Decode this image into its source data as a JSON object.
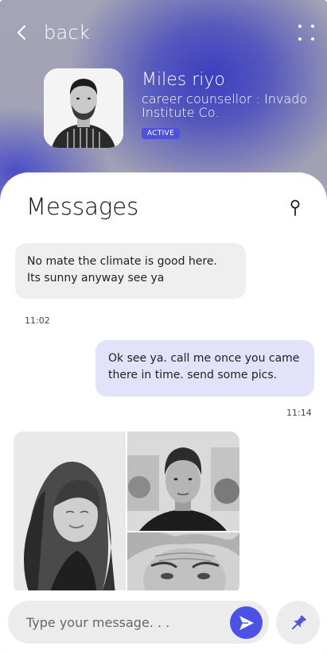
{
  "header": {
    "back_label": "back",
    "back_icon": "chevron-left-icon",
    "menu_icon": "four-dots-icon"
  },
  "profile": {
    "name": "Miles riyo",
    "role": "career counsellor : Invado Institute Co.",
    "status": "ACTIVE",
    "status_color": "#4d52d8"
  },
  "messages": {
    "title": "Messages",
    "pin_icon": "pin-icon",
    "items": [
      {
        "direction": "incoming",
        "text": "No mate the climate is good here. Its sunny anyway see ya",
        "time": "11:02"
      },
      {
        "direction": "outgoing",
        "text": "Ok see ya. call me once you came there in time. send some pics.",
        "time": "11:14"
      }
    ],
    "photo_count": 3
  },
  "composer": {
    "placeholder": "Type your message. . .",
    "send_icon": "send-icon",
    "attach_icon": "pushpin-icon"
  },
  "colors": {
    "accent": "#4d52e6",
    "incoming_bubble": "#efefef",
    "outgoing_bubble": "#e2e3fb"
  }
}
